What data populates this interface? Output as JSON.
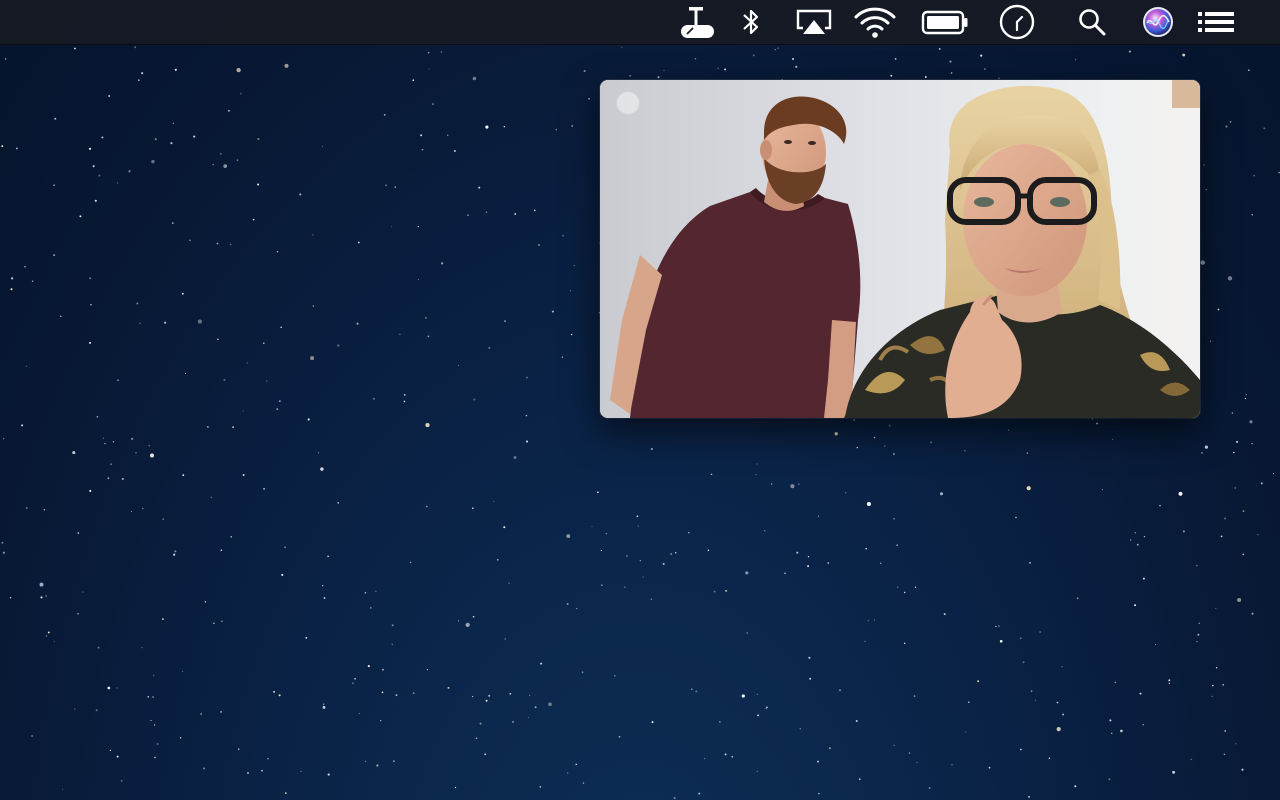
{
  "menubar": {
    "status_items": [
      {
        "icon": "microscope-icon"
      },
      {
        "icon": "bluetooth-icon"
      },
      {
        "icon": "airplay-icon"
      },
      {
        "icon": "wifi-icon"
      },
      {
        "icon": "battery-icon"
      },
      {
        "icon": "clock-icon"
      },
      {
        "icon": "spotlight-search-icon"
      },
      {
        "icon": "siri-icon"
      },
      {
        "icon": "notification-center-icon"
      }
    ]
  },
  "video_window": {
    "content": "video-call-feed",
    "has_close_button": true
  },
  "colors": {
    "menubar": "#161a24",
    "desktop_top": "#06142c",
    "desktop_bottom": "#0d2f57",
    "menu_icon": "#ffffff"
  }
}
